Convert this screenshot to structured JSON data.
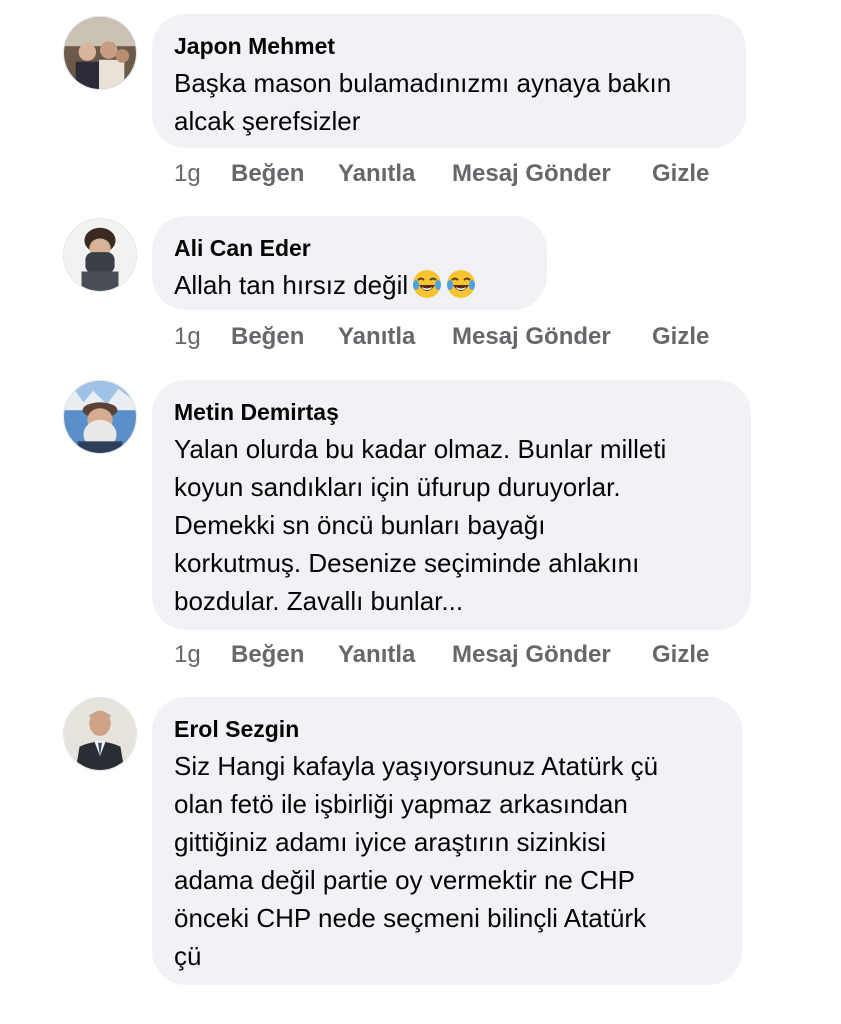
{
  "comments": [
    {
      "author": "Japon Mehmet",
      "text": "Başka mason bulamadınızmı aynaya bakın\nalcak şerefsizler",
      "time": "1g",
      "actions": [
        "Beğen",
        "Yanıtla",
        "Mesaj Gönder",
        "Gizle"
      ]
    },
    {
      "author": "Ali Can Eder",
      "text": "Allah tan hırsız değil",
      "emoji": [
        "face-with-tears-of-joy",
        "face-with-tears-of-joy"
      ],
      "time": "1g",
      "actions": [
        "Beğen",
        "Yanıtla",
        "Mesaj Gönder",
        "Gizle"
      ]
    },
    {
      "author": "Metin Demirtaş",
      "text": "Yalan olurda bu kadar olmaz. Bunlar milleti\nkoyun sandıkları için üfurup duruyorlar.\nDemekki sn öncü bunları bayağı\nkorkutmuş.  Desenize seçiminde ahlakını\nbozdular. Zavallı bunlar...",
      "time": "1g",
      "actions": [
        "Beğen",
        "Yanıtla",
        "Mesaj Gönder",
        "Gizle"
      ]
    },
    {
      "author": "Erol Sezgin",
      "text": "Siz Hangi kafayla yaşıyorsunuz Atatürk çü\nolan fetö ile işbirliği yapmaz arkasından\ngittiğiniz adamı iyice araştırın sizinkisi\nadama değil partie oy vermektir ne CHP\nönceki CHP nede seçmeni bilinçli Atatürk\nçü"
    }
  ],
  "colors": {
    "bubble": "#f0f2f5",
    "text": "#050505",
    "meta": "#65676b"
  }
}
